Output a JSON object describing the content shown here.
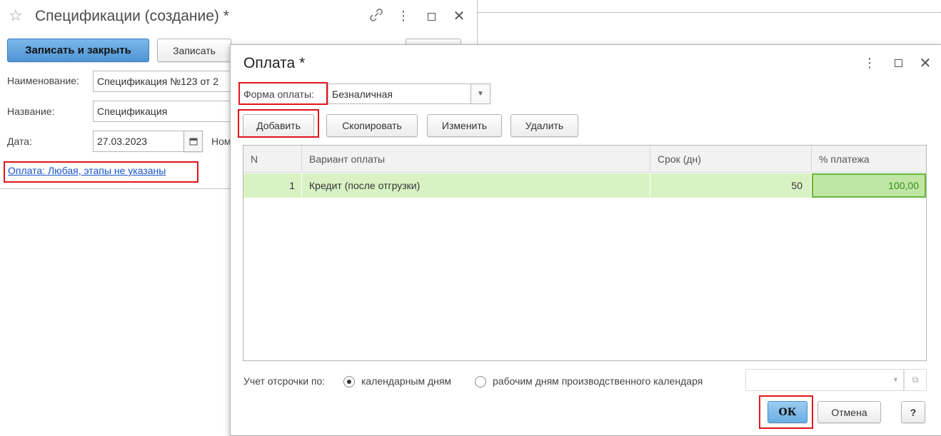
{
  "bg_form": {
    "title": "Спецификации (создание) *",
    "icons": [
      "star-icon",
      "link-icon",
      "more-icon",
      "maximize-icon",
      "close-icon"
    ],
    "save_close_label": "Записать и закрыть",
    "save_label": "Записать",
    "naimenovanie_label": "Наименование:",
    "naimenovanie_value": "Спецификация №123 от 2",
    "nazvanie_label": "Название:",
    "nazvanie_value": "Спецификация",
    "date_label": "Дата:",
    "date_value": "27.03.2023",
    "nomer_label": "Ном",
    "payment_link": "Оплата: Любая, этапы не указаны"
  },
  "dialog": {
    "title": "Оплата *",
    "icons": [
      "more-icon",
      "maximize-icon",
      "close-icon"
    ],
    "form_label": "Форма оплаты:",
    "form_value": "Безналичная",
    "toolbar": {
      "add": "Добавить",
      "copy": "Скопировать",
      "edit": "Изменить",
      "delete": "Удалить"
    },
    "table": {
      "headers": [
        "N",
        "Вариант оплаты",
        "Срок (дн)",
        "% платежа"
      ],
      "rows": [
        {
          "n": "1",
          "variant": "Кредит (после отгрузки)",
          "days": "50",
          "percent": "100,00"
        }
      ]
    },
    "deferral": {
      "label": "Учет отсрочки по:",
      "option1": "календарным дням",
      "option2": "рабочим дням производственного календаря",
      "selected": "option1"
    },
    "ok": "ОК",
    "cancel": "Отмена",
    "help": "?"
  },
  "colors": {
    "accent_button": "#5aa0d8",
    "selected_row": "#d9f2c4",
    "highlight_border": "#e0151b",
    "link": "#1a55c9"
  }
}
